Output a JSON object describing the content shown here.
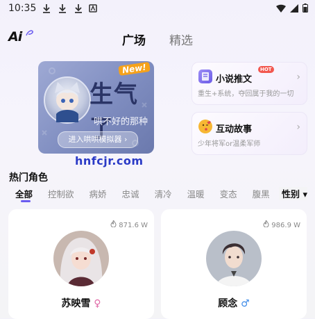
{
  "status_bar": {
    "time": "10:35"
  },
  "header": {
    "logo": "Ai",
    "tabs": [
      {
        "label": "广场"
      },
      {
        "label": "精选"
      }
    ]
  },
  "banner": {
    "badge": "New!",
    "title": "生气了",
    "subtitle": "哄不好的那种",
    "button_label": "进入哄哄模拟器 ›"
  },
  "side_cards": [
    {
      "title": "小说推文",
      "badge": "HOT",
      "desc": "重生+系统，夺回属于我的一切"
    },
    {
      "title": "互动故事",
      "desc": "少年将军or温柔军师"
    }
  ],
  "watermark": "hnfcjr.com",
  "hot_roles": {
    "title": "热门角色",
    "categories": [
      "全部",
      "控制欲",
      "病娇",
      "忠诚",
      "清冷",
      "温暖",
      "变态",
      "腹黑"
    ],
    "gender_filter": "性别 ▾"
  },
  "roles": [
    {
      "name": "苏映雪",
      "gender_symbol": "♀",
      "heat": "871.6 W"
    },
    {
      "name": "顾念",
      "gender_symbol": "♂",
      "heat": "986.9 W"
    }
  ],
  "colors": {
    "accent": "#6b5cf0",
    "female": "#e06aa7",
    "male": "#3c8ae8",
    "hot_badge": "#f2584f"
  }
}
